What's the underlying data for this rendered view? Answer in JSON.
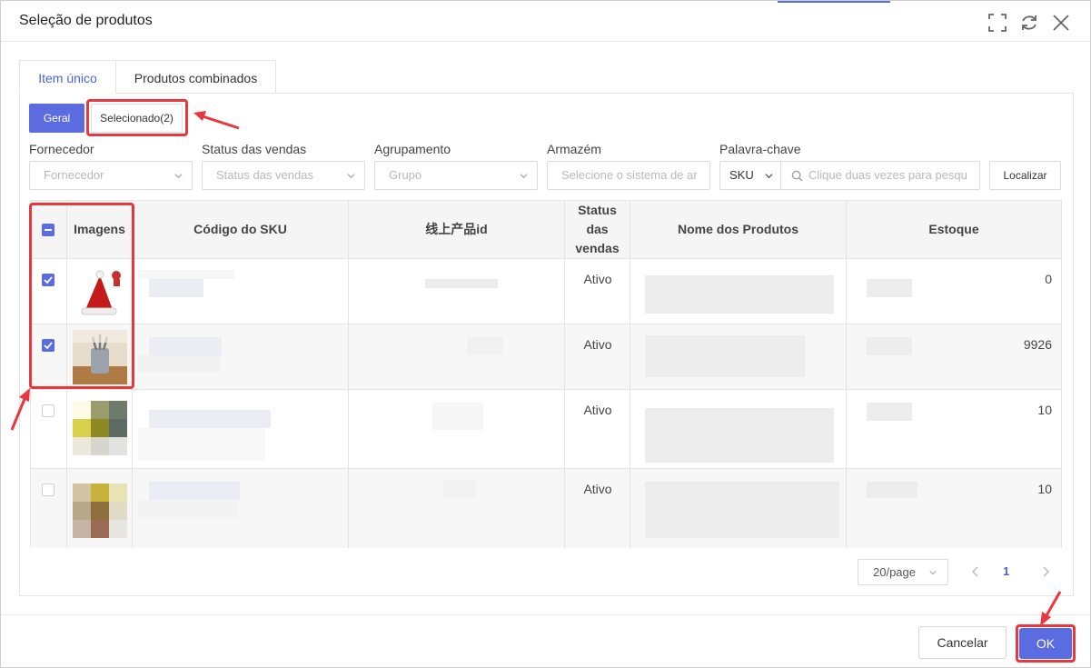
{
  "dialog": {
    "title": "Seleção de produtos",
    "icons": [
      "fullscreen-icon",
      "refresh-icon",
      "close-icon"
    ]
  },
  "tabs": [
    {
      "label": "Item único",
      "active": true
    },
    {
      "label": "Produtos combinados",
      "active": false
    }
  ],
  "view_toggle": {
    "general": "Geral",
    "selected": "Selecionado(2)"
  },
  "filters": {
    "supplier": {
      "label": "Fornecedor",
      "placeholder": "Fornecedor"
    },
    "sales_status": {
      "label": "Status das vendas",
      "placeholder": "Status das vendas"
    },
    "grouping": {
      "label": "Agrupamento",
      "placeholder": "Grupo"
    },
    "warehouse": {
      "label": "Armazém",
      "placeholder": "Selecione o sistema de ar"
    },
    "keyword": {
      "label": "Palavra-chave",
      "type_value": "SKU",
      "placeholder": "Clique duas vezes para pesqu"
    },
    "search_button": "Localizar"
  },
  "table": {
    "headers": [
      "Imagens",
      "Código do SKU",
      "线上产品id",
      "Status das vendas",
      "Nome dos Produtos",
      "Estoque"
    ],
    "rows": [
      {
        "checked": true,
        "status": "Ativo",
        "stock": "0"
      },
      {
        "checked": true,
        "status": "Ativo",
        "stock": "9926"
      },
      {
        "checked": false,
        "status": "Ativo",
        "stock": "10"
      },
      {
        "checked": false,
        "status": "Ativo",
        "stock": "10"
      }
    ]
  },
  "pagination": {
    "page_size": "20/page",
    "current_page": "1"
  },
  "footer": {
    "cancel": "Cancelar",
    "ok": "OK"
  },
  "colors": {
    "accent": "#5b6be0",
    "annotation": "#e8383d"
  }
}
